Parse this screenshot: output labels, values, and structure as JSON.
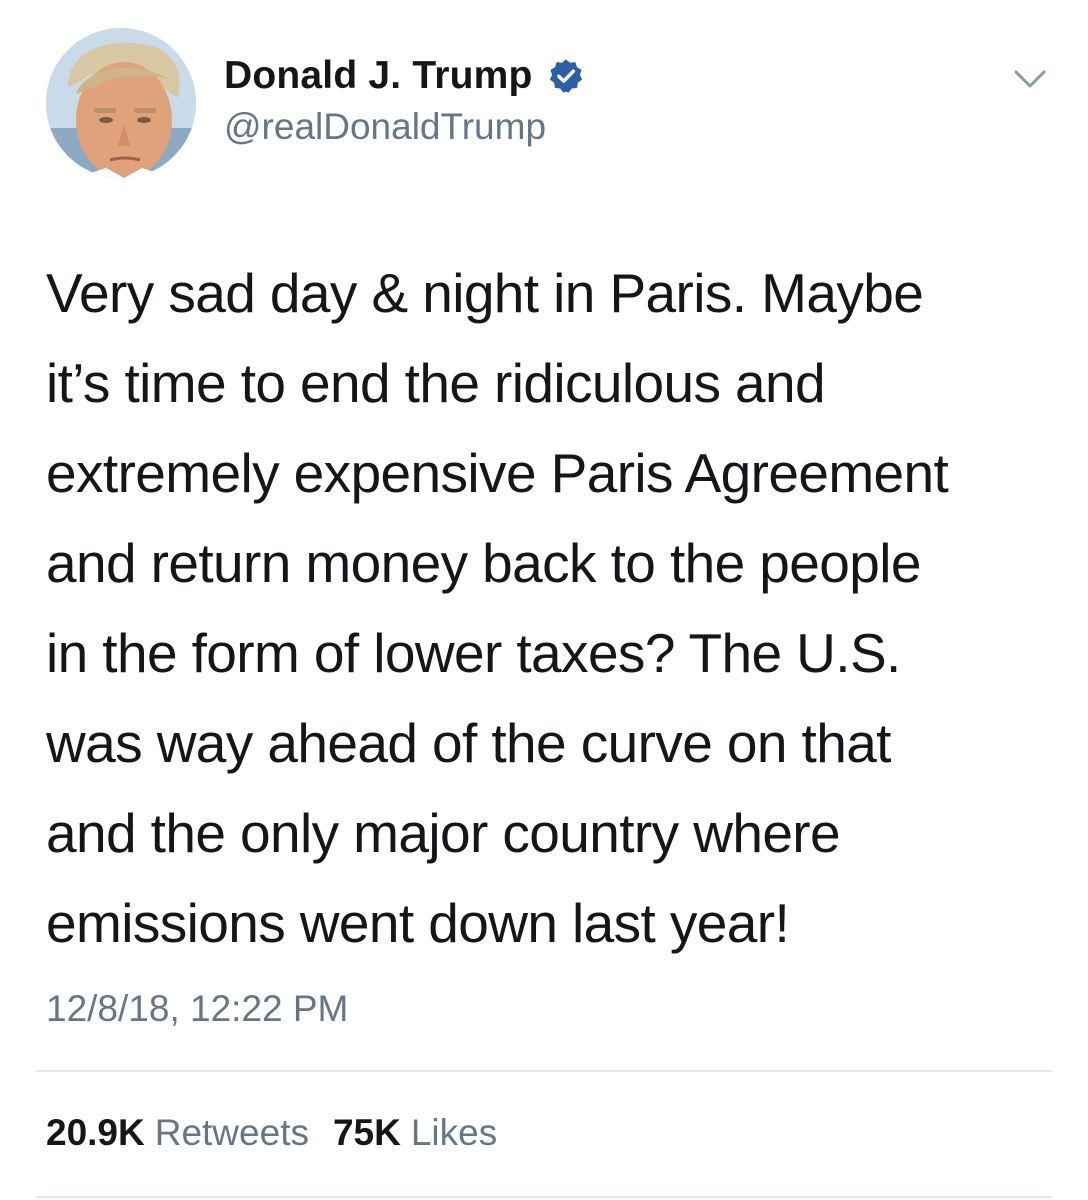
{
  "author": {
    "display_name": "Donald J. Trump",
    "handle": "@realDonaldTrump",
    "verified": true,
    "avatar_icon": "profile-photo",
    "verified_icon": "verified-badge-icon",
    "menu_icon": "chevron-down-icon"
  },
  "tweet": {
    "lines": [
      "Very sad day & night in Paris. Maybe",
      "it’s time to end the ridiculous and",
      "extremely expensive Paris Agreement",
      "and return money back to the people",
      "in the form of lower taxes? The U.S.",
      "was way ahead of the curve on that",
      "and the only major country where",
      "emissions went down last year!"
    ],
    "timestamp": "12/8/18, 12:22 PM"
  },
  "stats": {
    "retweets_count": "20.9K",
    "retweets_label": "Retweets",
    "likes_count": "75K",
    "likes_label": "Likes"
  },
  "colors": {
    "text_primary": "#14171a",
    "text_secondary": "#657786",
    "verified_blue": "#1da1f2",
    "divider": "#e1e8ed"
  }
}
